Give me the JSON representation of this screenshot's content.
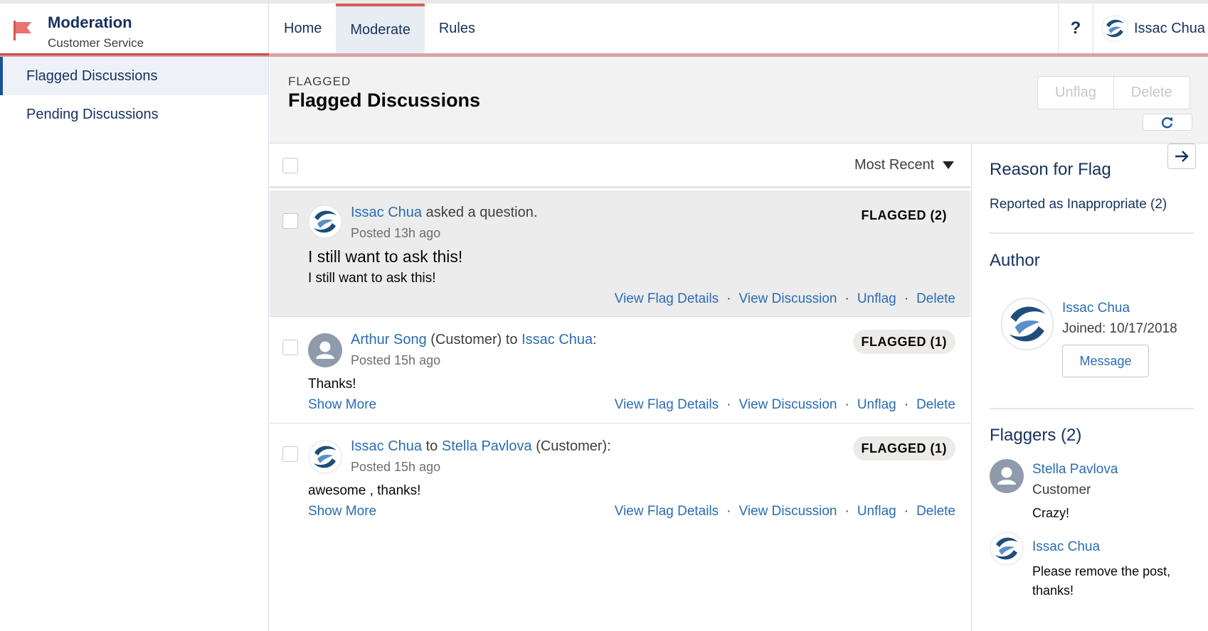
{
  "app": {
    "title": "Moderation",
    "subtitle": "Customer Service",
    "brand_color": "#d9534f"
  },
  "nav": {
    "tabs": [
      {
        "label": "Home"
      },
      {
        "label": "Moderate"
      },
      {
        "label": "Rules"
      }
    ],
    "active": "Moderate",
    "help_label": "?",
    "user_name": "Issac Chua"
  },
  "sidebar": {
    "items": [
      {
        "label": "Flagged Discussions"
      },
      {
        "label": "Pending Discussions"
      }
    ],
    "active": "Flagged Discussions"
  },
  "page": {
    "eyebrow": "FLAGGED",
    "title": "Flagged Discussions",
    "unflag_label": "Unflag",
    "delete_label": "Delete",
    "refresh_icon": "refresh-icon"
  },
  "list": {
    "sort_label": "Most Recent",
    "posts": [
      {
        "author": "Issac Chua",
        "verb": "asked a question.",
        "posted": "Posted 13h ago",
        "badge": "FLAGGED (2)",
        "title": "I still want to ask this!",
        "body": "I still want to ask this!",
        "selected": true
      },
      {
        "author": "Arthur Song",
        "author_role": "(Customer) to",
        "recipient": "Issac Chua",
        "suffix": ":",
        "posted": "Posted 15h ago",
        "badge": "FLAGGED (1)",
        "body": "Thanks!",
        "show_more": "Show More"
      },
      {
        "author": "Issac Chua",
        "to_word": "to",
        "recipient": "Stella Pavlova",
        "recipient_role": "(Customer):",
        "posted": "Posted 15h ago",
        "badge": "FLAGGED (1)",
        "body": "awesome , thanks!",
        "show_more": "Show More"
      }
    ],
    "actions": {
      "view_flag_details": "View Flag Details",
      "view_discussion": "View Discussion",
      "unflag": "Unflag",
      "delete": "Delete",
      "separator": "·"
    }
  },
  "panel": {
    "reason_title": "Reason for Flag",
    "reason_text": "Reported as Inappropriate (2)",
    "author_title": "Author",
    "author_name": "Issac Chua",
    "author_joined": "Joined: 10/17/2018",
    "message_label": "Message",
    "flaggers_title": "Flaggers (2)",
    "flaggers": [
      {
        "name": "Stella Pavlova",
        "role": "Customer",
        "note": "Crazy!"
      },
      {
        "name": "Issac Chua",
        "note_line1": "Please remove the post,",
        "note_line2": "thanks!"
      }
    ]
  }
}
